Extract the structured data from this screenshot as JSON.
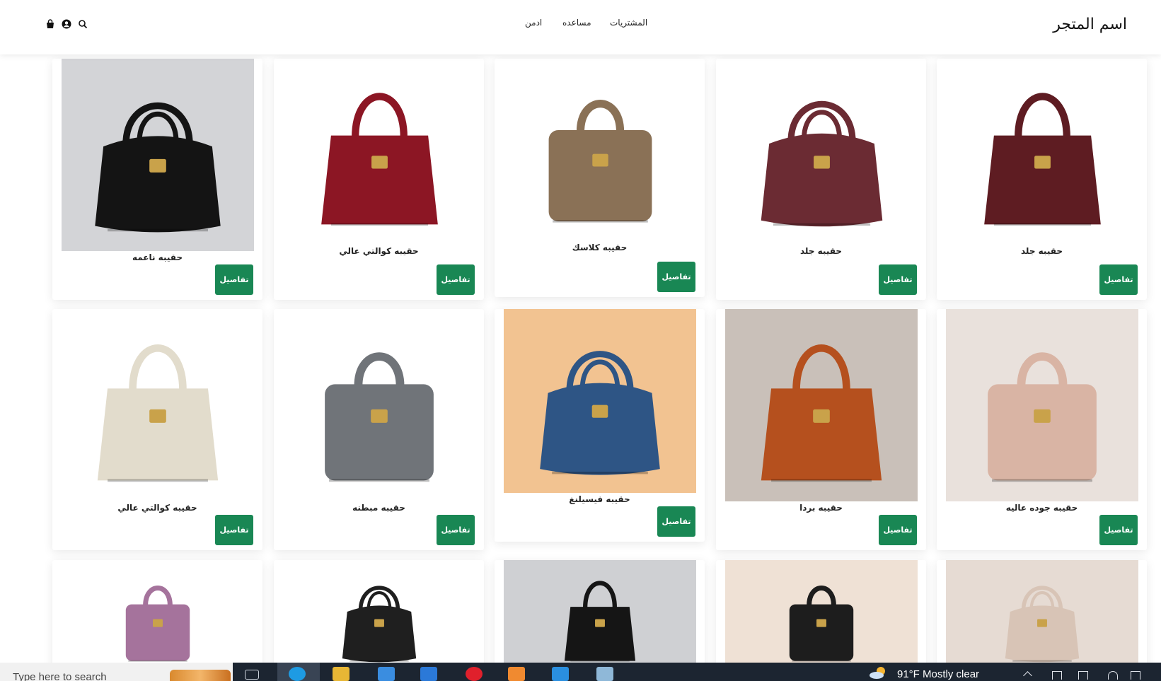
{
  "header": {
    "brand": "اسم المتجر",
    "nav": [
      {
        "label": "المشتريات"
      },
      {
        "label": "مساعده"
      },
      {
        "label": "ادمن"
      }
    ],
    "icons": [
      "search-icon",
      "user-icon",
      "shopping-bag-icon"
    ]
  },
  "button_label": "تفاصيل",
  "products": [
    {
      "name": "حقيبه جلد",
      "color": "#5e1c22"
    },
    {
      "name": "حقيبه جلد",
      "color": "#6b2b33"
    },
    {
      "name": "حقيبه كلاسك",
      "color": "#8a7156"
    },
    {
      "name": "حقيبه كوالتي عالي",
      "color": "#8c1624"
    },
    {
      "name": "حقيبه ناعمه",
      "color": "#141414"
    },
    {
      "name": "حقيبه جوده عاليه",
      "color": "#d9b4a4"
    },
    {
      "name": "حقيبه بردا",
      "color": "#b5501e"
    },
    {
      "name": "حقيبه فيسيلنغ",
      "color": "#2e5585"
    },
    {
      "name": "حقيبه مبطنه",
      "color": "#707479"
    },
    {
      "name": "حقيبه كوالتي عالي",
      "color": "#e2dccc"
    },
    {
      "name": "",
      "color": "#d8c4b6"
    },
    {
      "name": "",
      "color": "#1d1d1d"
    },
    {
      "name": "",
      "color": "#151515"
    },
    {
      "name": "",
      "color": "#1f1f1f"
    },
    {
      "name": "",
      "color": "#a5739c"
    }
  ],
  "taskbar": {
    "search_placeholder": "Type here to search",
    "weather": "91°F  Mostly clear"
  },
  "colors": {
    "button": "#198754",
    "taskbar": "#1c2531"
  }
}
